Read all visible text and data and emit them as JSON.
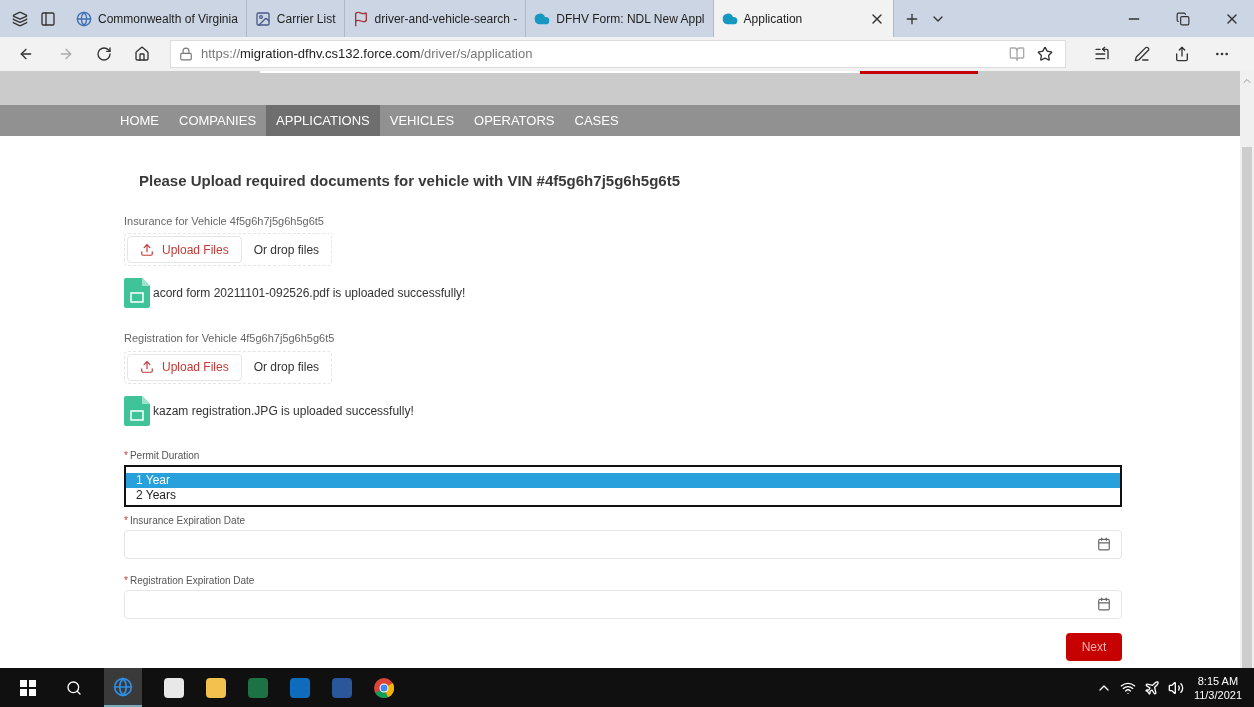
{
  "browser": {
    "tabs": [
      {
        "title": "Commonwealth of Virginia",
        "kind": "globe",
        "selected": false
      },
      {
        "title": "Carrier List",
        "kind": "image",
        "selected": false
      },
      {
        "title": "driver-and-vehicle-search -",
        "kind": "flag",
        "selected": false
      },
      {
        "title": "DFHV Form: NDL New Appl",
        "kind": "cloud",
        "selected": false
      },
      {
        "title": "Application",
        "kind": "cloud",
        "selected": true
      }
    ],
    "url_prefix": "https://",
    "url_host": "migration-dfhv.cs132.force.com",
    "url_path": "/driver/s/application"
  },
  "nav": [
    {
      "label": "HOME",
      "selected": false
    },
    {
      "label": "COMPANIES",
      "selected": false
    },
    {
      "label": "APPLICATIONS",
      "selected": true
    },
    {
      "label": "VEHICLES",
      "selected": false
    },
    {
      "label": "OPERATORS",
      "selected": false
    },
    {
      "label": "CASES",
      "selected": false
    }
  ],
  "heading": "Please Upload required documents for vehicle with VIN #4f5g6h7j5g6h5g6t5",
  "uploads": [
    {
      "label": "Insurance for Vehicle 4f5g6h7j5g6h5g6t5",
      "button": "Upload Files",
      "drop_text": "Or drop files",
      "file_message": "acord form 20211101-092526.pdf is uploaded successfully!"
    },
    {
      "label": "Registration for Vehicle 4f5g6h7j5g6h5g6t5",
      "button": "Upload Files",
      "drop_text": "Or drop files",
      "file_message": "kazam registration.JPG is uploaded successfully!"
    }
  ],
  "permit": {
    "required_mark": "*",
    "label": "Permit Duration",
    "options": [
      {
        "label": "1 Year",
        "selected": true
      },
      {
        "label": "2 Years",
        "selected": false
      }
    ]
  },
  "date_fields": [
    {
      "required_mark": "*",
      "label": "Insurance Expiration Date"
    },
    {
      "required_mark": "*",
      "label": "Registration Expiration Date"
    }
  ],
  "next_button": "Next",
  "taskbar": {
    "time": "8:15 AM",
    "date": "11/3/2021"
  }
}
